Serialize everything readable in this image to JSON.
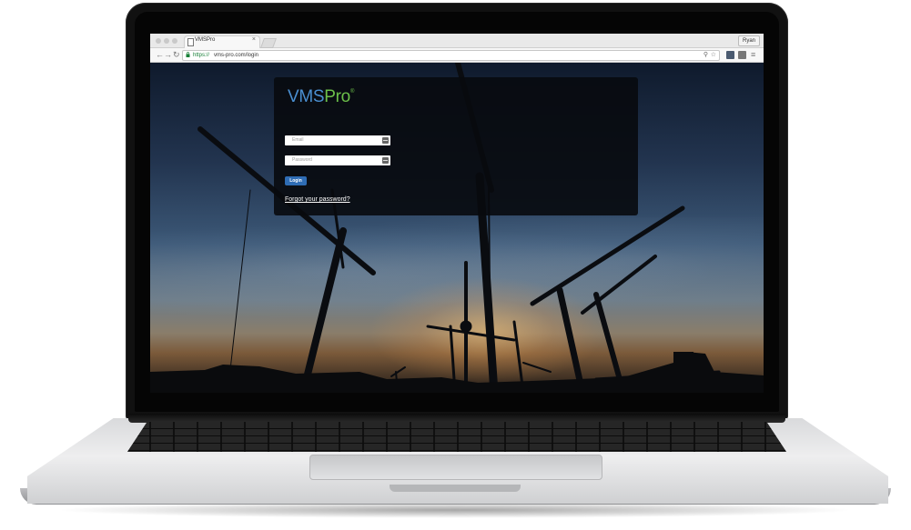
{
  "browser": {
    "tab_title": "VMSPro",
    "tab_close": "×",
    "user_chip": "Ryan",
    "url_scheme": "https://",
    "url_rest": "vms-pro.com/login",
    "back_icon": "back-arrow-icon",
    "forward_icon": "forward-arrow-icon",
    "reload_icon": "reload-icon",
    "back_glyph": "←",
    "forward_glyph": "→",
    "reload_glyph": "↻",
    "search_glyph": "⚲",
    "star_glyph": "☆",
    "menu_glyph": "≡"
  },
  "login": {
    "logo_part1": "VMS",
    "logo_part2": "Pro",
    "logo_mark": "®",
    "email_placeholder": "Email",
    "password_placeholder": "Password",
    "login_button": "Login",
    "forgot_link": "Forgot your password?"
  },
  "colors": {
    "logo_blue": "#4a8fd1",
    "logo_green": "#6cc04a",
    "button_blue": "#2f6db5",
    "https_green": "#188038"
  }
}
